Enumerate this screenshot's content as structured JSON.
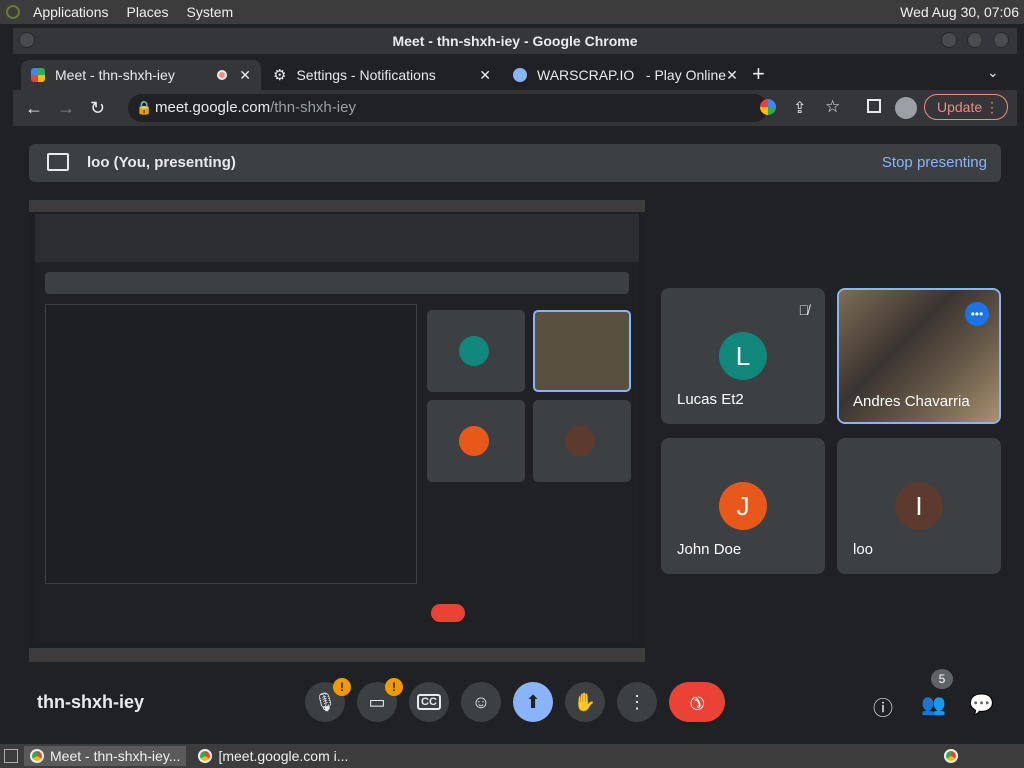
{
  "top_panel": {
    "menus": [
      "Applications",
      "Places",
      "System"
    ],
    "clock": "Wed Aug 30, 07:06"
  },
  "window": {
    "title": "Meet - thn-shxh-iey - Google Chrome"
  },
  "tabs": [
    {
      "label": "Meet - thn-shxh-iey",
      "active": true
    },
    {
      "label": "Settings - Notifications",
      "active": false
    },
    {
      "label": "WARSCRAP.IO   - Play Online",
      "active": false
    }
  ],
  "toolbar": {
    "url_host": "meet.google.com",
    "url_path": "/thn-shxh-iey",
    "update_label": "Update"
  },
  "meet": {
    "presenting_label": "loo (You, presenting)",
    "stop_presenting_label": "Stop presenting",
    "meeting_name": "thn-shxh-iey",
    "participants": [
      {
        "name": "Lucas Et2",
        "initial": "L",
        "color": "#12877b",
        "muted": true
      },
      {
        "name": "Andres Chavarria",
        "initial": "",
        "video": true
      },
      {
        "name": "John Doe",
        "initial": "J",
        "color": "#e8581a"
      },
      {
        "name": "loo",
        "initial": "I",
        "color": "#5d3a2e"
      }
    ],
    "controls": {
      "mic_badge": "!",
      "cam_badge": "!",
      "people_count": "5"
    }
  },
  "taskbar": {
    "items": [
      "Meet - thn-shxh-iey...",
      "[meet.google.com i..."
    ]
  },
  "colors": {
    "accent": "#8ab4f8",
    "end_call": "#ea4335",
    "warning": "#f29900"
  }
}
